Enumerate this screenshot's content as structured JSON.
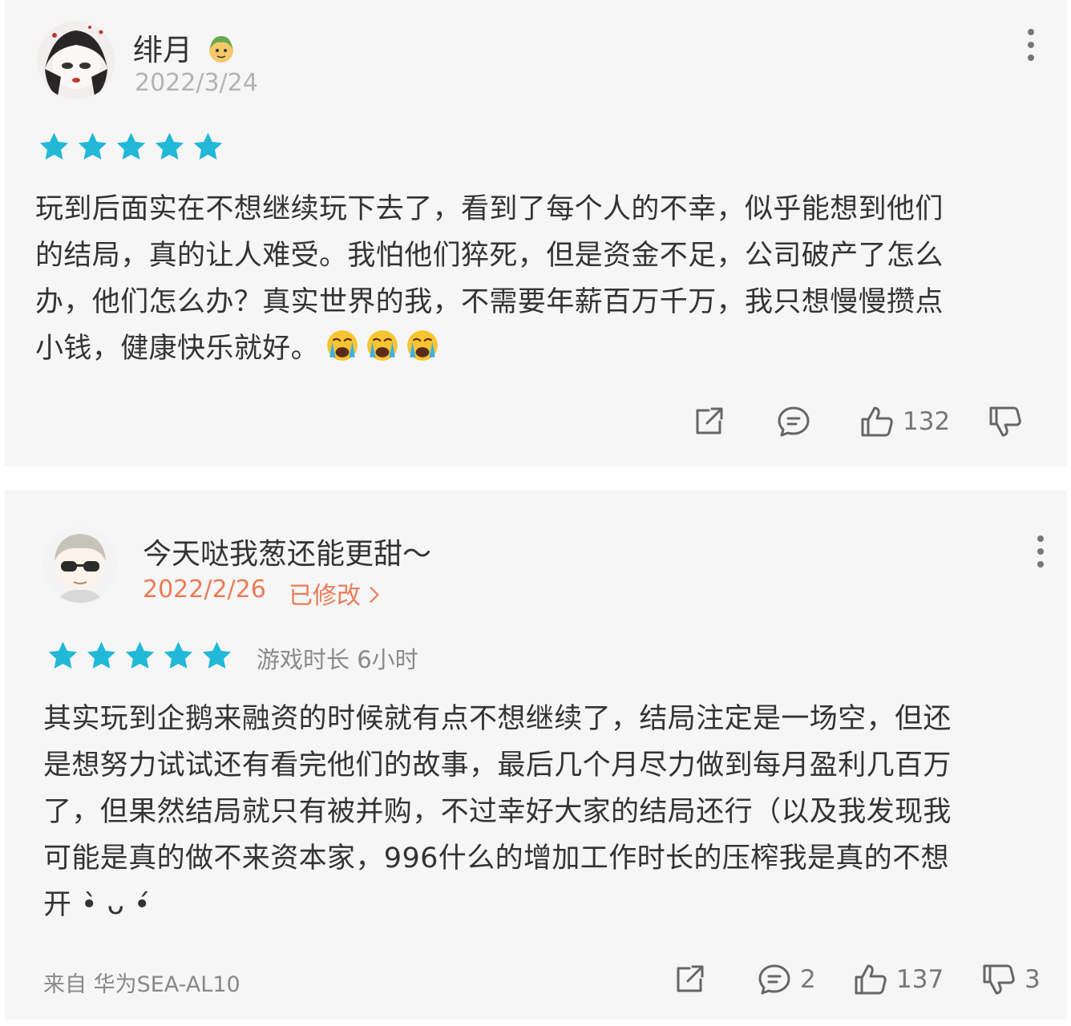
{
  "reviews": [
    {
      "username": "绯月",
      "date": "2022/3/24",
      "rating": 5,
      "lines": [
        "玩到后面实在不想继续玩下去了，看到了每个人的不幸，似乎能想到他们",
        "的结局，真的让人难受。我怕他们猝死，但是资金不足，公司破产了怎么",
        "办，他们怎么办？真实世界的我，不需要年薪百万千万，我只想慢慢攒点",
        "小钱，健康快乐就好。"
      ],
      "likes": "132"
    },
    {
      "username": "今天哒我葱还能更甜～",
      "date": "2022/2/26",
      "edited_label": "已修改",
      "rating": 5,
      "playtime": "游戏时长 6小时",
      "lines": [
        "其实玩到企鹅来融资的时候就有点不想继续了，结局注定是一场空，但还",
        "是想努力试试还有看完他们的故事，最后几个月尽力做到每月盈利几百万",
        "了，但果然结局就只有被并购，不过幸好大家的结局还行（以及我发现我",
        "可能是真的做不来资本家，996什么的增加工作时长的压榨我是真的不想",
        "开 •̀ ᴗ •́ "
      ],
      "device": "来自 华为SEA-AL10",
      "comments": "2",
      "likes": "137",
      "dislikes": "3"
    }
  ],
  "colors": {
    "star": "#22b8d8",
    "accent_orange": "#ec7b55"
  },
  "icons": [
    "more-vertical-icon",
    "star-icon",
    "share-icon",
    "comment-icon",
    "thumbs-up-icon",
    "thumbs-down-icon",
    "crying-emoji-icon"
  ]
}
